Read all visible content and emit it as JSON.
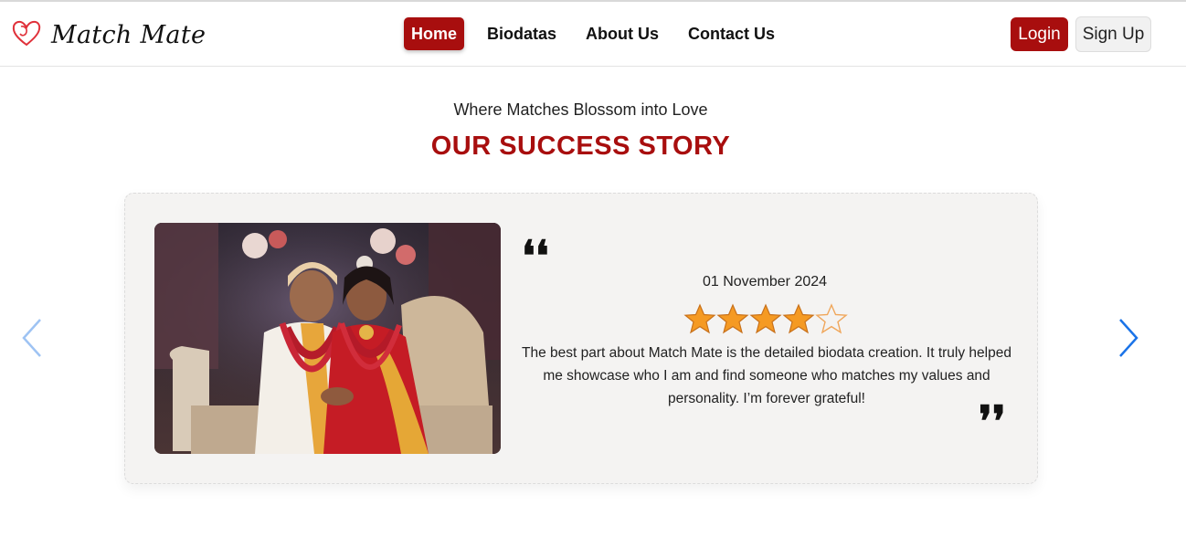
{
  "brand": {
    "name": "Match Mate",
    "icon": "heart-logo-icon",
    "accent": "#a80e0e"
  },
  "nav": {
    "items": [
      {
        "label": "Home",
        "active": true
      },
      {
        "label": "Biodatas",
        "active": false
      },
      {
        "label": "About Us",
        "active": false
      },
      {
        "label": "Contact Us",
        "active": false
      }
    ]
  },
  "auth": {
    "login_label": "Login",
    "signup_label": "Sign Up"
  },
  "section": {
    "tagline": "Where Matches Blossom into Love",
    "heading": "OUR SUCCESS STORY"
  },
  "story": {
    "date": "01 November 2024",
    "rating": 4,
    "rating_max": 5,
    "review": "The best part about Match Mate is the detailed biodata creation. It truly helped me showcase who I am and find someone who matches my values and personality. I’m forever grateful!",
    "quote_open": "❛❛",
    "quote_close": "❜❜"
  },
  "carousel": {
    "prev_icon": "chevron-left-icon",
    "next_icon": "chevron-right-icon"
  },
  "colors": {
    "primary": "#a80e0e",
    "star": "#f59a23",
    "arrow": "#1a73e8"
  }
}
